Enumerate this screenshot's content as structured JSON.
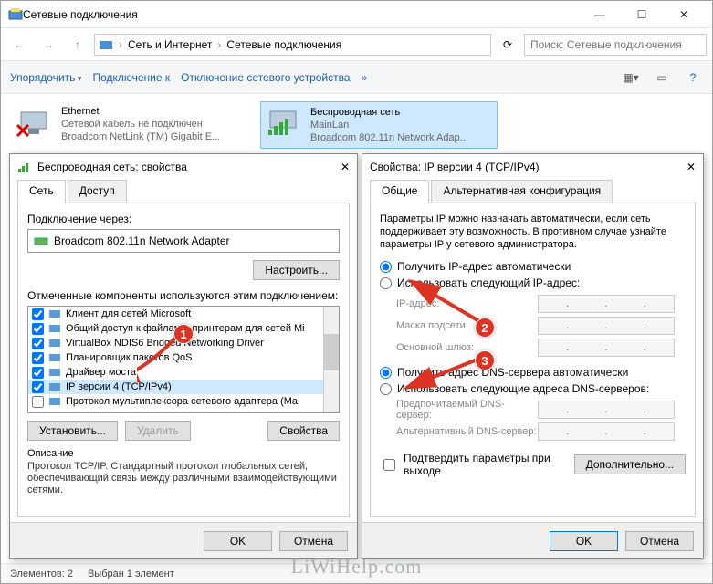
{
  "main": {
    "title": "Сетевые подключения",
    "breadcrumb": {
      "part1": "Сеть и Интернет",
      "part2": "Сетевые подключения"
    },
    "search_placeholder": "Поиск: Сетевые подключения",
    "toolbar": {
      "organize": "Упорядочить",
      "connect": "Подключение к",
      "disable": "Отключение сетевого устройства"
    },
    "items": [
      {
        "name": "Ethernet",
        "status": "Сетевой кабель не подключен",
        "device": "Broadcom NetLink (TM) Gigabit E..."
      },
      {
        "name": "Беспроводная сеть",
        "status": "MainLan",
        "device": "Broadcom 802.11n Network Adap..."
      }
    ],
    "statusbar": {
      "count": "Элементов: 2",
      "selected": "Выбран 1 элемент"
    }
  },
  "props_dialog": {
    "title": "Беспроводная сеть: свойства",
    "tabs": {
      "net": "Сеть",
      "access": "Доступ"
    },
    "connect_via": "Подключение через:",
    "adapter": "Broadcom 802.11n Network Adapter",
    "configure": "Настроить...",
    "components_label": "Отмеченные компоненты используются этим подключением:",
    "components": [
      {
        "checked": true,
        "label": "Клиент для сетей Microsoft"
      },
      {
        "checked": true,
        "label": "Общий доступ к файлам и принтерам для сетей Mi"
      },
      {
        "checked": true,
        "label": "VirtualBox NDIS6 Bridged Networking Driver"
      },
      {
        "checked": true,
        "label": "Планировщик пакетов QoS"
      },
      {
        "checked": true,
        "label": "Драйвер моста"
      },
      {
        "checked": true,
        "label": "IP версии 4 (TCP/IPv4)",
        "selected": true
      },
      {
        "checked": false,
        "label": "Протокол мультиплексора сетевого адаптера (Ma"
      }
    ],
    "install": "Установить...",
    "remove": "Удалить",
    "properties": "Свойства",
    "desc_title": "Описание",
    "desc_text": "Протокол TCP/IP. Стандартный протокол глобальных сетей, обеспечивающий связь между различными взаимодействующими сетями.",
    "ok": "OK",
    "cancel": "Отмена"
  },
  "ipv4_dialog": {
    "title": "Свойства: IP версии 4 (TCP/IPv4)",
    "tabs": {
      "general": "Общие",
      "alt": "Альтернативная конфигурация"
    },
    "info": "Параметры IP можно назначать автоматически, если сеть поддерживает эту возможность. В противном случае узнайте параметры IP у сетевого администратора.",
    "radio_auto_ip": "Получить IP-адрес автоматически",
    "radio_manual_ip": "Использовать следующий IP-адрес:",
    "ip_label": "IP-адрес:",
    "mask_label": "Маска подсети:",
    "gateway_label": "Основной шлюз:",
    "radio_auto_dns": "Получить адрес DNS-сервера автоматически",
    "radio_manual_dns": "Использовать следующие адреса DNS-серверов:",
    "dns1_label": "Предпочитаемый DNS-сервер:",
    "dns2_label": "Альтернативный DNS-сервер:",
    "confirm_exit": "Подтвердить параметры при выходе",
    "advanced": "Дополнительно...",
    "ok": "OK",
    "cancel": "Отмена"
  },
  "watermark": "LiWiHelp.com",
  "annotations": {
    "b1": "1",
    "b2": "2",
    "b3": "3"
  }
}
